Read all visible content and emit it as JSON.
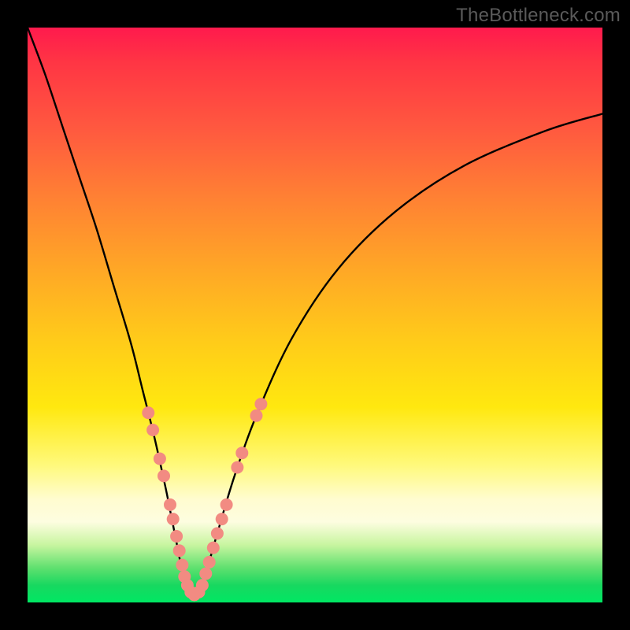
{
  "watermark": "TheBottleneck.com",
  "colors": {
    "frame": "#000000",
    "curve": "#000000",
    "dot_fill": "#f28b82",
    "dot_stroke": "#c44a4a"
  },
  "chart_data": {
    "type": "line",
    "title": "",
    "xlabel": "",
    "ylabel": "",
    "xlim": [
      0,
      100
    ],
    "ylim": [
      0,
      100
    ],
    "series": [
      {
        "name": "bottleneck-curve",
        "x": [
          0,
          3,
          6,
          9,
          12,
          15,
          18,
          20,
          22,
          24,
          25,
          26,
          27,
          28,
          29,
          30,
          31,
          33,
          36,
          40,
          46,
          54,
          64,
          76,
          90,
          100
        ],
        "y": [
          100,
          92,
          83,
          74,
          65,
          55,
          45,
          37,
          29,
          20,
          15,
          10,
          5,
          2,
          1,
          2,
          5,
          12,
          22,
          33,
          46,
          58,
          68,
          76,
          82,
          85
        ]
      }
    ],
    "dots": {
      "name": "highlight-dots",
      "points": [
        {
          "x": 21.0,
          "y": 33.0
        },
        {
          "x": 21.8,
          "y": 30.0
        },
        {
          "x": 23.0,
          "y": 25.0
        },
        {
          "x": 23.7,
          "y": 22.0
        },
        {
          "x": 24.8,
          "y": 17.0
        },
        {
          "x": 25.3,
          "y": 14.5
        },
        {
          "x": 25.9,
          "y": 11.5
        },
        {
          "x": 26.4,
          "y": 9.0
        },
        {
          "x": 26.9,
          "y": 6.5
        },
        {
          "x": 27.3,
          "y": 4.5
        },
        {
          "x": 27.8,
          "y": 3.0
        },
        {
          "x": 28.4,
          "y": 1.8
        },
        {
          "x": 29.0,
          "y": 1.3
        },
        {
          "x": 29.8,
          "y": 1.8
        },
        {
          "x": 30.4,
          "y": 3.0
        },
        {
          "x": 31.0,
          "y": 5.0
        },
        {
          "x": 31.6,
          "y": 7.0
        },
        {
          "x": 32.3,
          "y": 9.5
        },
        {
          "x": 33.0,
          "y": 12.0
        },
        {
          "x": 33.8,
          "y": 14.5
        },
        {
          "x": 34.6,
          "y": 17.0
        },
        {
          "x": 36.5,
          "y": 23.5
        },
        {
          "x": 37.3,
          "y": 26.0
        },
        {
          "x": 39.8,
          "y": 32.5
        },
        {
          "x": 40.6,
          "y": 34.5
        }
      ]
    }
  }
}
